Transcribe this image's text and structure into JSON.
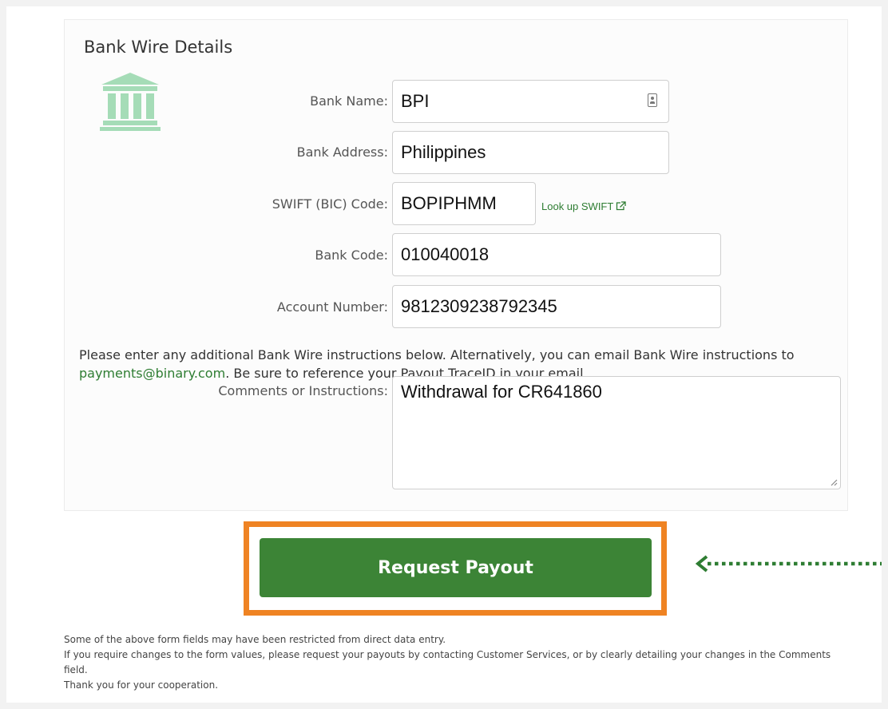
{
  "section": {
    "title": "Bank Wire Details",
    "icon": "bank-icon"
  },
  "fields": {
    "bank_name": {
      "label": "Bank Name:",
      "value": "BPI"
    },
    "bank_address": {
      "label": "Bank Address:",
      "value": "Philippines"
    },
    "swift": {
      "label": "SWIFT (BIC) Code:",
      "value": "BOPIPHMM",
      "lookup_link": "Look up SWIFT"
    },
    "bank_code": {
      "label": "Bank Code:",
      "value": "010040018"
    },
    "account_number": {
      "label": "Account Number:",
      "value": "9812309238792345"
    }
  },
  "instructions": {
    "text_before": "Please enter any additional Bank Wire instructions below. Alternatively, you can email Bank Wire instructions to ",
    "email": "payments@binary.com",
    "text_after": ". Be sure to reference your Payout TraceID in your email."
  },
  "comments": {
    "label": "Comments or Instructions:",
    "value": "Withdrawal for CR641860"
  },
  "button": {
    "label": "Request Payout"
  },
  "footer": {
    "line1": "Some of the above form fields may have been restricted from direct data entry.",
    "line2": "If you require changes to the form values, please request your payouts by contacting Customer Services, or by clearly detailing your changes in the Comments field.",
    "line3": "Thank you for your cooperation."
  },
  "colors": {
    "accent_green": "#3c8436",
    "link_green": "#2e7d32",
    "highlight_orange": "#ef8323",
    "icon_green": "#a5dcb7"
  }
}
